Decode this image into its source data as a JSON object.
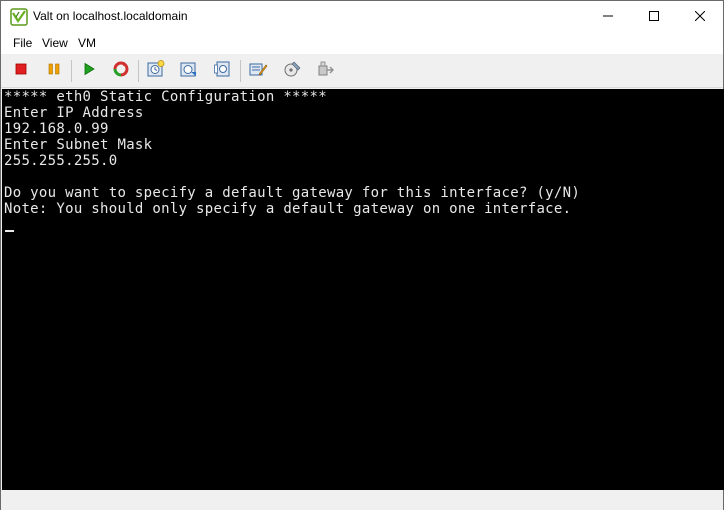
{
  "window": {
    "title": "Valt on localhost.localdomain",
    "app_icon": "vmware-logo-icon"
  },
  "title_controls": {
    "minimize_icon": "minimize-icon",
    "maximize_icon": "maximize-icon",
    "close_icon": "close-icon"
  },
  "menu": {
    "file": "File",
    "view": "View",
    "vm": "VM"
  },
  "toolbar": {
    "buttons": [
      {
        "name": "stop-button",
        "icon": "stop-icon",
        "color": "#e02020"
      },
      {
        "name": "pause-button",
        "icon": "pause-icon",
        "color": "#f0a000"
      },
      {
        "name": "play-button",
        "icon": "play-icon",
        "color": "#20a020"
      },
      {
        "name": "reset-button",
        "icon": "reset-icon",
        "color": "#d03030"
      },
      {
        "name": "take-snapshot-button",
        "icon": "snapshot-icon"
      },
      {
        "name": "revert-snapshot-button",
        "icon": "revert-snapshot-icon"
      },
      {
        "name": "snapshot-manager-button",
        "icon": "snapshot-manager-icon"
      },
      {
        "name": "edit-settings-button",
        "icon": "edit-settings-icon"
      },
      {
        "name": "install-tools-button",
        "icon": "install-tools-icon"
      },
      {
        "name": "connect-device-button",
        "icon": "connect-device-icon"
      }
    ]
  },
  "console": {
    "lines": [
      "***** eth0 Static Configuration *****",
      "Enter IP Address",
      "192.168.0.99",
      "Enter Subnet Mask",
      "255.255.255.0",
      "",
      "Do you want to specify a default gateway for this interface? (y/N)",
      "Note: You should only specify a default gateway on one interface."
    ]
  }
}
